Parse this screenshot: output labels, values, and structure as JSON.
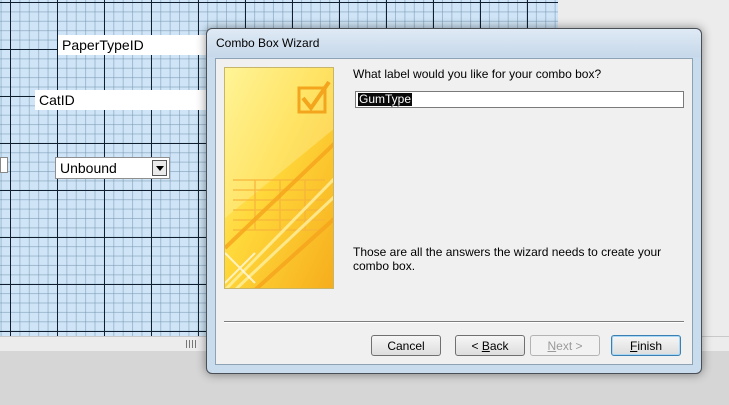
{
  "designer": {
    "controls": {
      "paper_type_id": "PaperTypeID",
      "cat_id": "CatID",
      "combo_unbound": "Unbound"
    }
  },
  "dialog": {
    "title": "Combo Box Wizard",
    "question": "What label would you like for your combo box?",
    "label_value": "GumType",
    "info": "Those are all the answers the wizard needs to create your combo box.",
    "buttons": {
      "cancel": "Cancel",
      "back_prefix": "< ",
      "back_mnemonic": "B",
      "back_rest": "ack",
      "next_mnemonic": "N",
      "next_rest": "ext >",
      "finish_mnemonic": "F",
      "finish_rest": "inish"
    }
  },
  "colors": {
    "grid_background": "#cfe5f7",
    "selection": "#0a0a0a",
    "art_yellow": "#ffd83a",
    "art_orange": "#f4a21a"
  }
}
